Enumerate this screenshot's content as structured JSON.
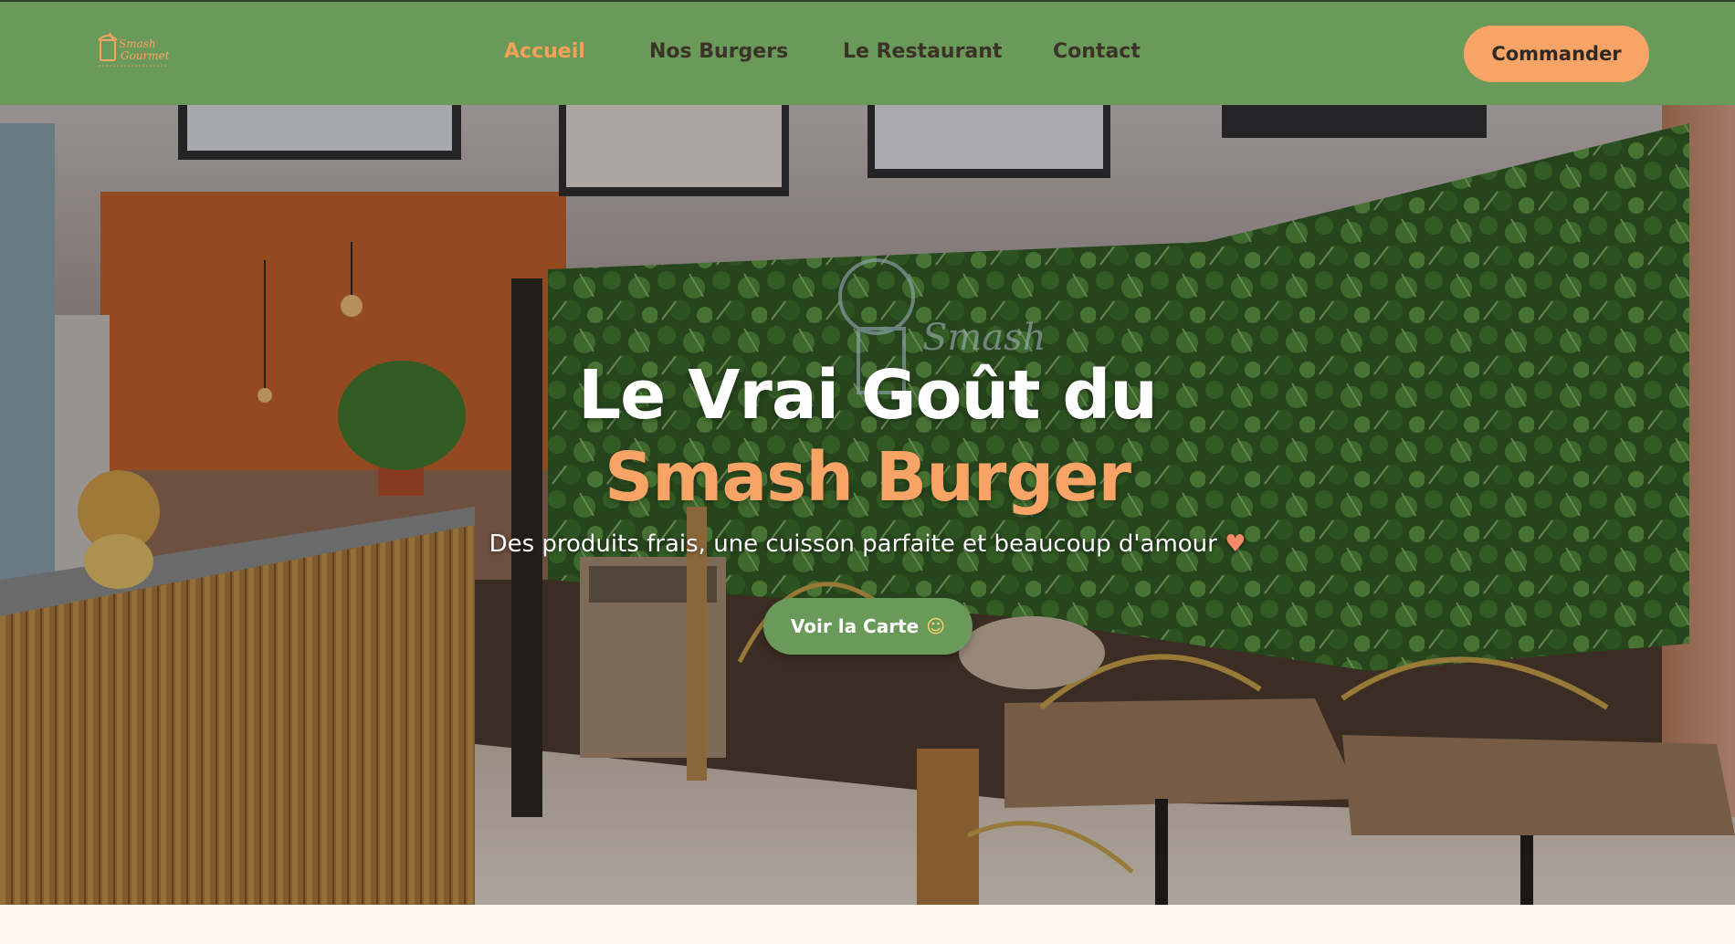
{
  "brand": {
    "logo_line1": "Smash",
    "logo_line2": "Gourmet",
    "accent": "#f7a466",
    "green": "#6a9a5a"
  },
  "nav": {
    "items": [
      {
        "label": "Accueil",
        "active": true
      },
      {
        "label": "Nos Burgers",
        "active": false
      },
      {
        "label": "Le Restaurant",
        "active": false
      },
      {
        "label": "Contact",
        "active": false
      }
    ],
    "cta_label": "Commander"
  },
  "hero": {
    "title_line1": "Le Vrai Goût du",
    "title_line2": "Smash Burger",
    "subtitle": "Des produits frais, une cuisson parfaite et beaucoup d'amour",
    "subtitle_emoji": "♥",
    "button_label": "Voir la Carte",
    "button_emoji": "☺"
  }
}
